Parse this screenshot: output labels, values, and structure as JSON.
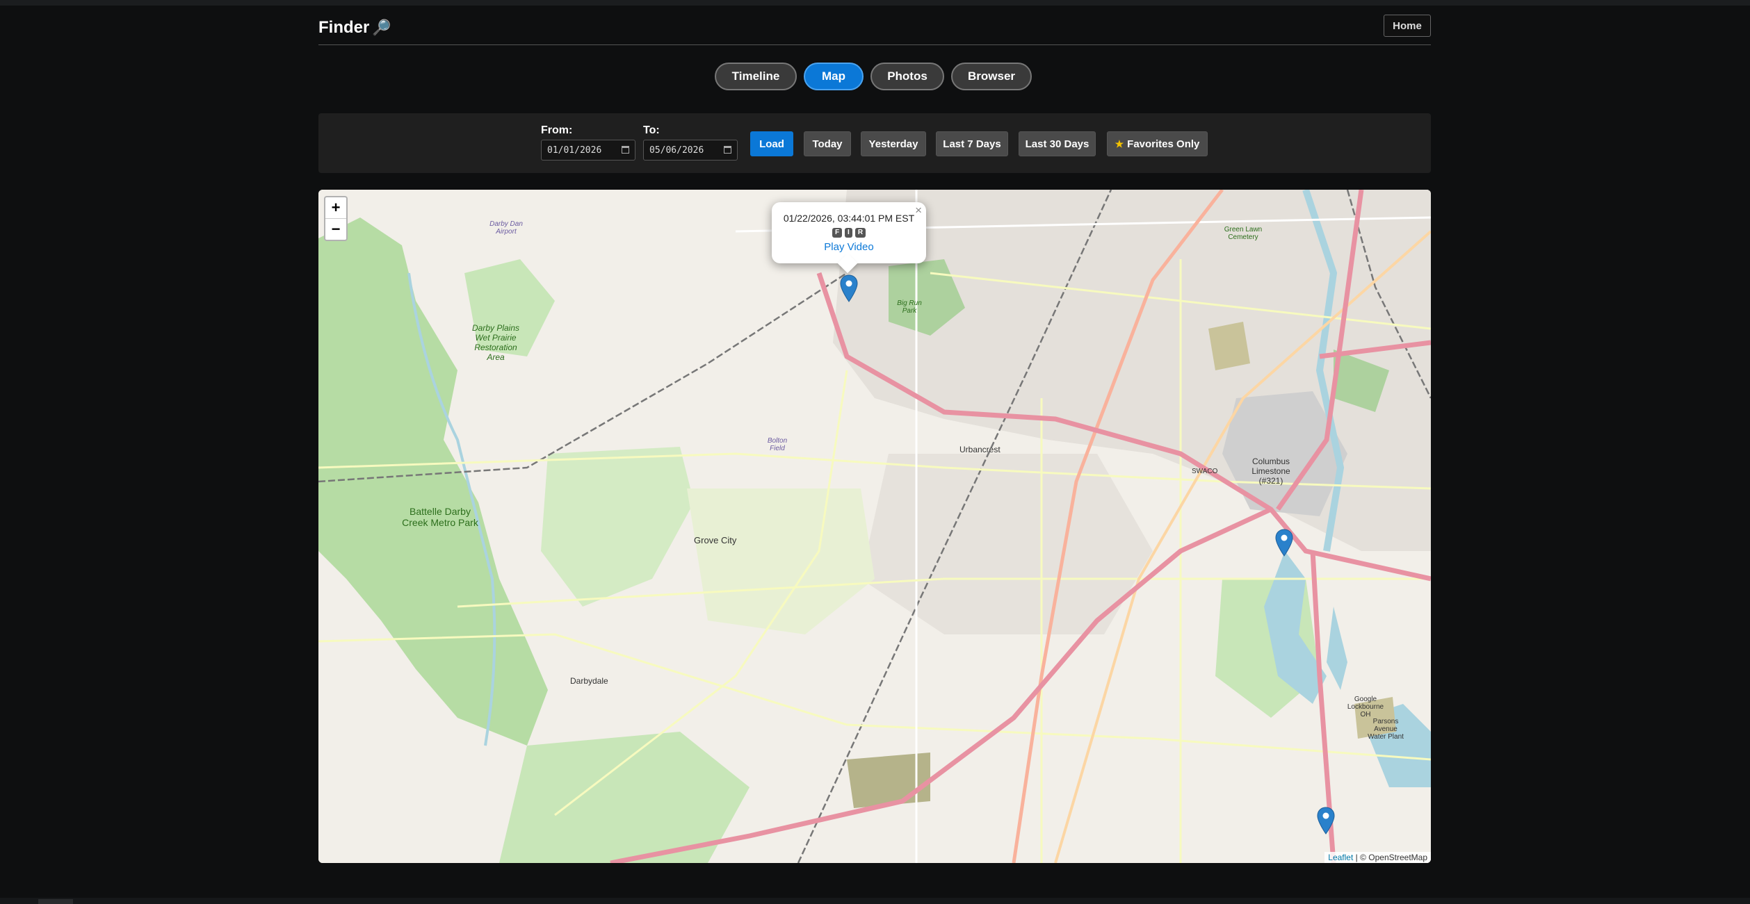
{
  "app": {
    "title": "Finder",
    "home_label": "Home"
  },
  "tabs": [
    {
      "label": "Timeline",
      "active": false
    },
    {
      "label": "Map",
      "active": true
    },
    {
      "label": "Photos",
      "active": false
    },
    {
      "label": "Browser",
      "active": false
    }
  ],
  "filters": {
    "from_label": "From:",
    "from_value": "01/01/2026",
    "to_label": "To:",
    "to_value": "05/06/2026",
    "load_label": "Load",
    "today_label": "Today",
    "yesterday_label": "Yesterday",
    "last7_label": "Last 7 Days",
    "last30_label": "Last 30 Days",
    "favorites_label": "Favorites Only"
  },
  "map": {
    "zoom_in": "+",
    "zoom_out": "−",
    "popup": {
      "timestamp": "01/22/2026, 03:44:01 PM EST",
      "badges": [
        "F",
        "I",
        "R"
      ],
      "play_label": "Play Video",
      "close": "×"
    },
    "attribution": {
      "leaflet": "Leaflet",
      "osm": "| © OpenStreetMap"
    },
    "labels": {
      "grove_city": "Grove City",
      "urbancrest": "Urbancrest",
      "darbydale": "Darbydale",
      "battelle": "Battelle Darby Creek Metro Park",
      "darby_plains": "Darby Plains Wet Prairie Restoration Area",
      "darby_dan": "Darby Dan Airport",
      "bolton": "Bolton Field",
      "columbus_limestone": "Columbus Limestone (#321)",
      "big_run": "Big Run Park",
      "green_lawn": "Green Lawn Cemetery",
      "google": "Google Lockbourne OH",
      "parsons": "Parsons Avenue Water Plant",
      "swaco": "SWACO"
    }
  },
  "colors": {
    "accent": "#0b78d7",
    "background": "#0e0f10",
    "toolbar": "#1f1f1f",
    "marker": "#2a81cb"
  }
}
